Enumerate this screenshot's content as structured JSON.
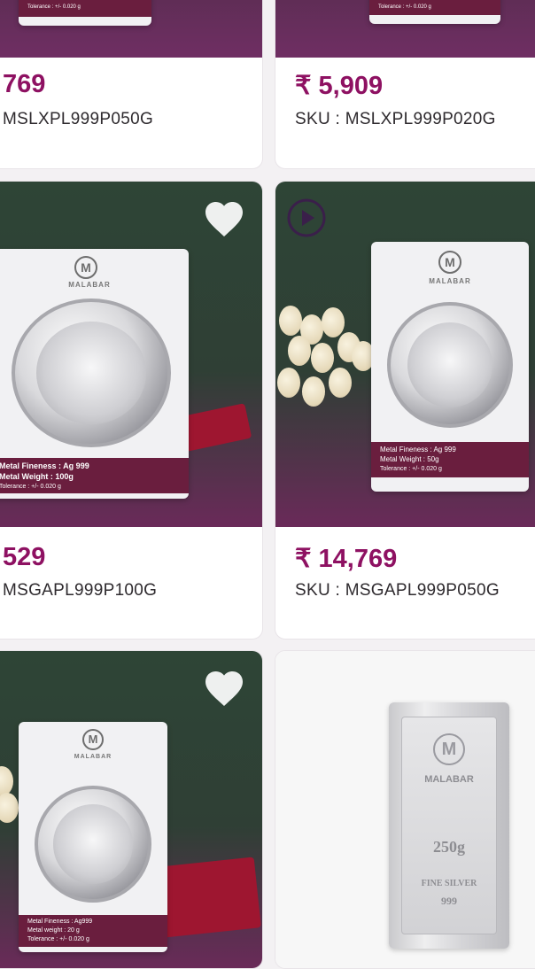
{
  "products": [
    {
      "price": "769",
      "sku": "MSLXPL999P050G"
    },
    {
      "price": "₹ 5,909",
      "sku": "SKU : MSLXPL999P020G"
    },
    {
      "price": "529",
      "sku": "MSGAPL999P100G"
    },
    {
      "price": "₹ 14,769",
      "sku": "SKU : MSGAPL999P050G"
    }
  ],
  "pack_100g": {
    "brand": "MALABAR",
    "fineness": "Metal Fineness :  Ag 999",
    "weight": "Metal Weight    :  100g",
    "tolerance": "Tolerance          :  +/- 0.020 g"
  },
  "pack_50g": {
    "brand": "MALABAR",
    "fineness": "Metal Fineness :  Ag 999",
    "weight": "Metal Weight    :  50g",
    "tolerance": "Tolerance          :  +/- 0.020 g"
  },
  "pack_bottom": {
    "brand": "MALABAR",
    "fineness": "Metal Fineness :  Ag999",
    "weight": "Metal weight    :  20 g",
    "tolerance": "Tolerance          :  +/- 0.020 g"
  },
  "pack_top_right": {
    "tolerance": "Tolerance   :  +/- 0.020 g"
  },
  "pack_top_left": {
    "tolerance": "Tolerance   :  +/- 0.020 g"
  },
  "silver_bar": {
    "brand": "MALABAR",
    "weight": "250g",
    "purity_label": "FINE SILVER",
    "purity": "999"
  },
  "icons": {
    "wishlist": "heart-icon",
    "video": "play-icon",
    "logo": "M"
  },
  "colors": {
    "price": "#8e1162",
    "label_band": "#6a1e3e",
    "ribbon": "#9e1630"
  }
}
